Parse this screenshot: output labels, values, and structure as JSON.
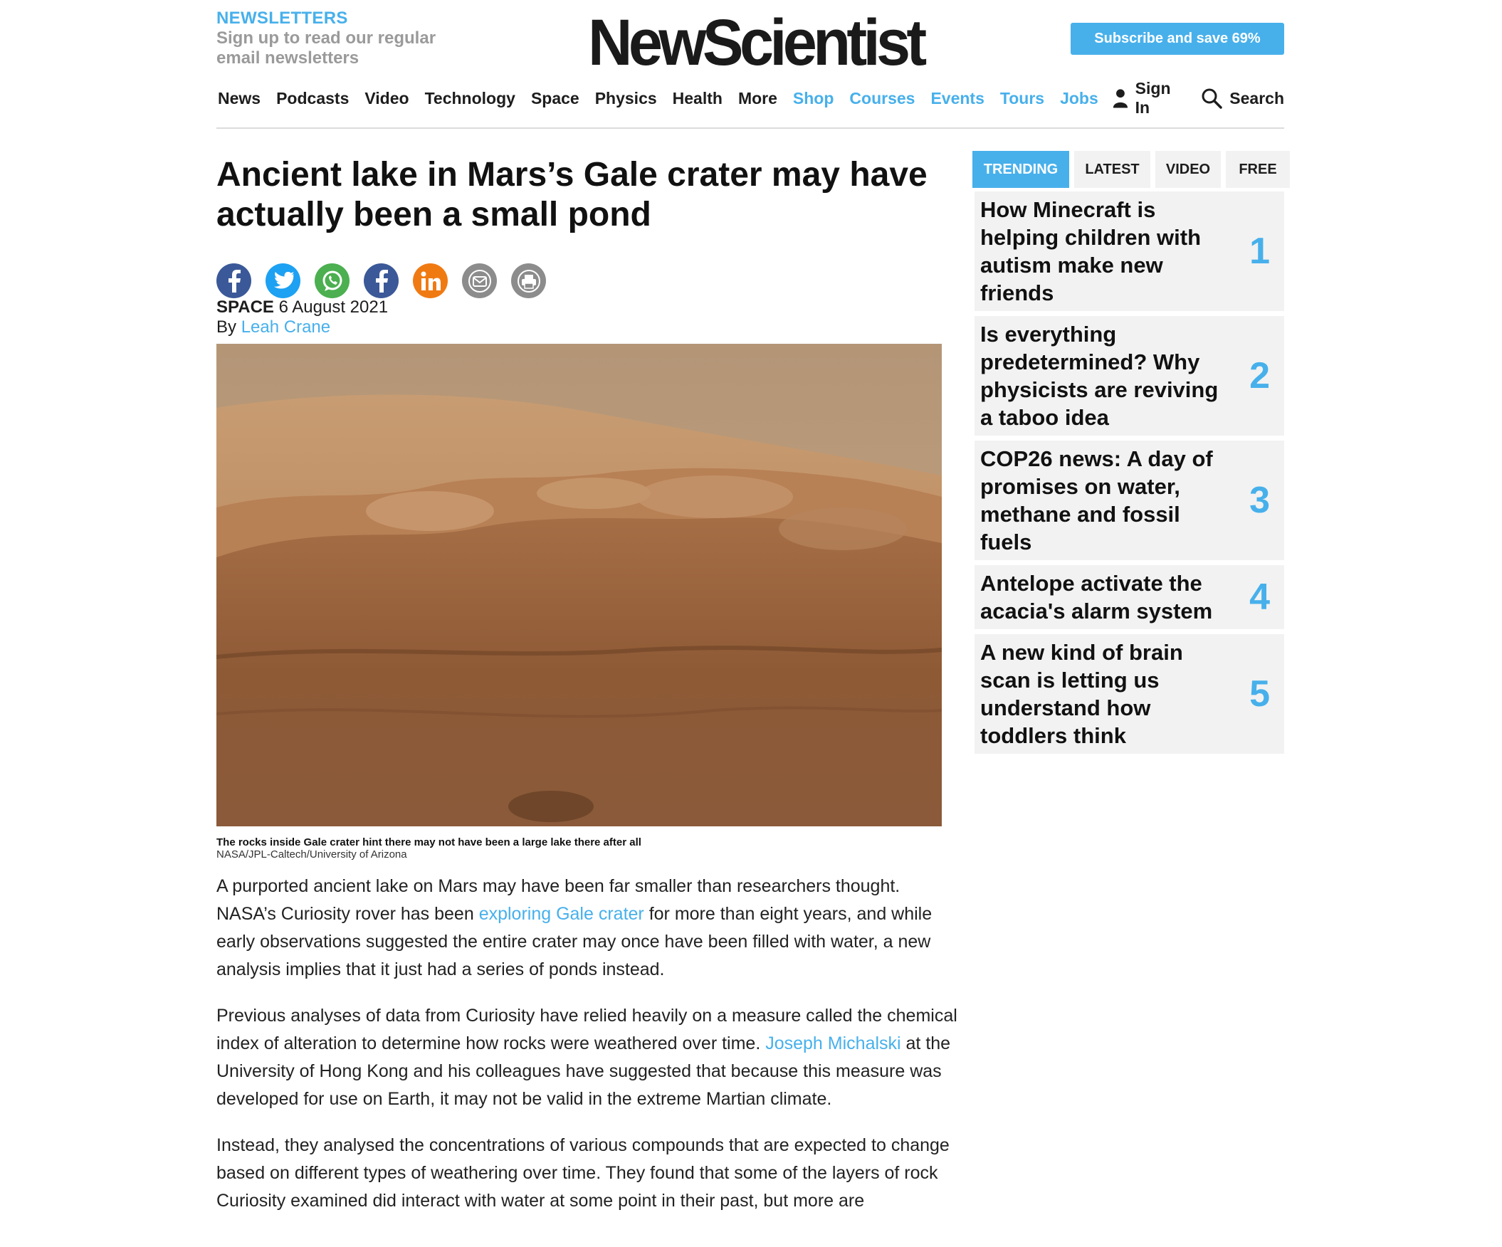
{
  "header": {
    "newsletters_title": "NEWSLETTERS",
    "newsletters_sub": "Sign up to read our regular email newsletters",
    "logo": "NewScientist",
    "subscribe_label": "Subscribe and save 69%",
    "nav": {
      "news": "News",
      "podcasts": "Podcasts",
      "video": "Video",
      "technology": "Technology",
      "space": "Space",
      "physics": "Physics",
      "health": "Health",
      "more": "More",
      "shop": "Shop",
      "courses": "Courses",
      "events": "Events",
      "tours": "Tours",
      "jobs": "Jobs",
      "sign_in": "Sign In",
      "search": "Search"
    }
  },
  "article": {
    "headline": "Ancient lake in Mars’s Gale crater may have actually been a small pond",
    "category": "SPACE",
    "date": "6 August 2021",
    "by": "By",
    "author": "Leah Crane",
    "caption": "The rocks inside Gale crater hint there may not have been a large lake there after all",
    "credit": "NASA/JPL-Caltech/University of Arizona",
    "p1_a": "A purported ancient lake on Mars may have been far smaller than researchers thought. NASA’s Curiosity rover has been ",
    "p1_link": "exploring Gale crater",
    "p1_b": " for more than eight years, and while early observations suggested the entire crater may once have been filled with water, a new analysis implies that it just had a series of ponds instead.",
    "p2_a": "Previous analyses of data from Curiosity have relied heavily on a measure called the chemical index of alteration to determine how rocks were weathered over time. ",
    "p2_link": "Joseph Michalski",
    "p2_b": " at the University of Hong Kong and his colleagues have suggested that because this measure was developed for use on Earth, it may not be valid in the extreme Martian climate.",
    "p3": "Instead, they analysed the concentrations of various compounds that are expected to change based on different types of weathering over time. They found that some of the layers of rock Curiosity examined did interact with water at some point in their past, but more are"
  },
  "sidebar": {
    "tabs": {
      "trending": "TRENDING",
      "latest": "LATEST",
      "video": "VIDEO",
      "free": "FREE"
    },
    "items": [
      {
        "title": "How Minecraft is helping children with autism make new friends",
        "rank": "1"
      },
      {
        "title": "Is everything predetermined? Why physicists are reviving a taboo idea",
        "rank": "2"
      },
      {
        "title": "COP26 news: A day of promises on water, methane and fossil fuels",
        "rank": "3"
      },
      {
        "title": "Antelope activate the acacia's alarm system",
        "rank": "4"
      },
      {
        "title": "A new kind of brain scan is letting us understand how toddlers think",
        "rank": "5"
      }
    ]
  },
  "colors": {
    "accent": "#47b0eb",
    "facebook": "#3b5998",
    "twitter": "#1da1f2",
    "whatsapp": "#4caf50",
    "linkedin": "#f07a12",
    "email": "#8c8c8c",
    "print": "#8c8c8c"
  }
}
